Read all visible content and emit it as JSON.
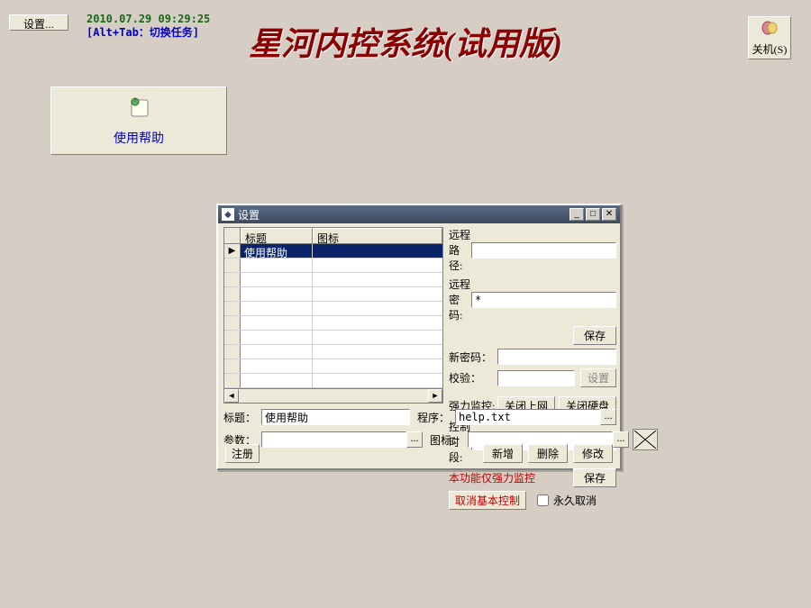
{
  "top": {
    "settings_label": "设置...",
    "datetime": "2010.07.29 09:29:25",
    "switch_hint": "[Alt+Tab：切换任务]"
  },
  "app_title": "星河内控系统(试用版)",
  "shutdown": {
    "label": "关机(S)"
  },
  "help_tile": {
    "label": "使用帮助"
  },
  "dialog": {
    "title": "设置",
    "grid": {
      "col1": "标题",
      "col2": "图标",
      "rows": [
        {
          "title": "使用帮助",
          "icon": ""
        }
      ]
    },
    "right": {
      "remote_path_label": "远程路径:",
      "remote_path": "",
      "remote_pwd_label": "远程密码:",
      "remote_pwd": "*",
      "save": "保存",
      "new_pwd_label": "新密码：",
      "new_pwd": "",
      "verify_label": "校验：",
      "verify": "",
      "set_btn": "设置",
      "force_label": "强力监控:",
      "close_net": "关闭上网",
      "close_disk": "关闭硬盘",
      "period_label": "控制时段:",
      "period": "",
      "note": "本功能仅强力监控",
      "save2": "保存",
      "cancel_basic": "取消基本控制",
      "forever_cancel": "永久取消"
    },
    "bottom": {
      "title_label": "标题：",
      "title_val": "使用帮助",
      "program_label": "程序：",
      "program_val": "help.txt",
      "params_label": "参数：",
      "params_val": "",
      "icon_label": "图标：",
      "icon_val": ""
    },
    "footer": {
      "register": "注册",
      "add": "新增",
      "delete": "删除",
      "modify": "修改"
    }
  }
}
